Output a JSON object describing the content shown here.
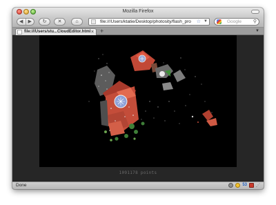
{
  "window": {
    "title": "Mozilla Firefox"
  },
  "toolbar": {
    "back_label": "◀",
    "forward_label": "▶",
    "reload_label": "↻",
    "stop_label": "✕",
    "home_label": "⌂",
    "url": "file:///Users/ktatie/Desktop/photosity/flash_pro",
    "search_placeholder": "Google"
  },
  "tabs": [
    {
      "label": "file:///Users/stu...CloudEditor.html"
    }
  ],
  "new_tab_label": "+",
  "content": {
    "caption": "1091178 points"
  },
  "statusbar": {
    "status": "Done",
    "counter": "53"
  },
  "colors": {
    "canvas": "#000000",
    "page_bg": "#262626",
    "roof_red": "#d24a38",
    "window_blue": "#8fa2d8"
  }
}
